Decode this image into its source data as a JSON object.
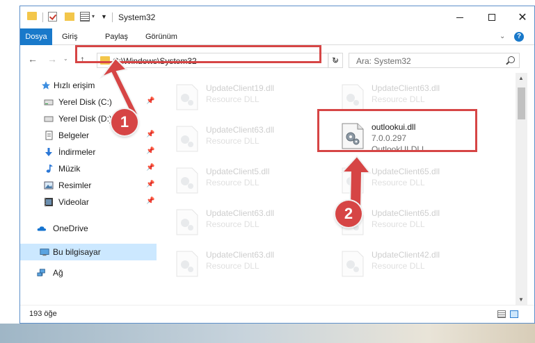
{
  "window": {
    "title": "System32"
  },
  "title_buttons": {
    "minimize_icon": "minimize-icon",
    "maximize_icon": "maximize-icon",
    "close": "✕"
  },
  "ribbon": {
    "tabs": [
      {
        "label": "Dosya",
        "active": true
      },
      {
        "label": "Giriş"
      },
      {
        "label": "Paylaş"
      },
      {
        "label": "Görünüm"
      }
    ],
    "collapse": "⌄",
    "help": "?"
  },
  "nav": {
    "back": "←",
    "forward": "→",
    "recent": "⌄",
    "up": "↑",
    "address": "C:\\Windows\\System32",
    "address_chevron": "⌄",
    "refresh": "↻",
    "search_placeholder": "Ara: System32"
  },
  "sidebar": {
    "items": [
      {
        "label": "Hızlı erişim",
        "icon": "star-icon"
      },
      {
        "label": "Yerel Disk (C:)",
        "icon": "drive-icon",
        "pinned": true
      },
      {
        "label": "Yerel Disk (D:)",
        "icon": "drive-icon",
        "pinned": false
      },
      {
        "label": "Belgeler",
        "icon": "documents-icon",
        "pinned": true
      },
      {
        "label": "İndirmeler",
        "icon": "downloads-icon",
        "pinned": true
      },
      {
        "label": "Müzik",
        "icon": "music-icon",
        "pinned": true
      },
      {
        "label": "Resimler",
        "icon": "pictures-icon",
        "pinned": true
      },
      {
        "label": "Videolar",
        "icon": "videos-icon",
        "pinned": true
      },
      {
        "label": "OneDrive",
        "icon": "cloud-icon"
      },
      {
        "label": "Bu bilgisayar",
        "icon": "computer-icon",
        "selected": true
      },
      {
        "label": "Ağ",
        "icon": "network-icon"
      }
    ],
    "pin_glyph": "📌"
  },
  "files": {
    "left": [
      {
        "name": "UpdateClient19.dll",
        "type": "Resource DLL"
      },
      {
        "name": "UpdateClient63.dll",
        "type": "Resource DLL"
      },
      {
        "name": "UpdateClient5.dll",
        "type": "Resource DLL"
      },
      {
        "name": "UpdateClient63.dll",
        "type": "Resource DLL"
      },
      {
        "name": "UpdateClient63.dll",
        "type": "Resource DLL"
      }
    ],
    "right": [
      {
        "name": "UpdateClient63.dll",
        "type": "Resource DLL"
      },
      {
        "name": "outlookui.dll",
        "version": "7.0.0.297",
        "type": "OutlookUI DLL",
        "highlighted": true
      },
      {
        "name": "UpdateClient65.dll",
        "type": "Resource DLL"
      },
      {
        "name": "UpdateClient65.dll",
        "type": "Resource DLL"
      },
      {
        "name": "UpdateClient42.dll",
        "type": "Resource DLL"
      }
    ]
  },
  "annotations": {
    "step1": "1",
    "step2": "2",
    "color": "#d64545"
  },
  "status": {
    "item_count": "193 öğe"
  },
  "colors": {
    "accent": "#1979ca",
    "selection": "#cce8ff",
    "folder": "#f3c64a"
  }
}
